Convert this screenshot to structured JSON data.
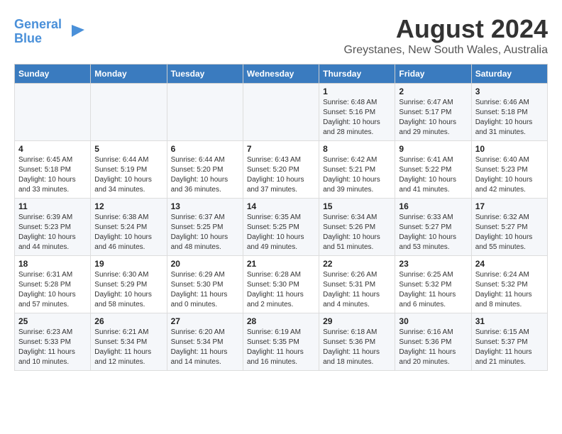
{
  "header": {
    "logo_line1": "General",
    "logo_line2": "Blue",
    "main_title": "August 2024",
    "subtitle": "Greystanes, New South Wales, Australia"
  },
  "days_of_week": [
    "Sunday",
    "Monday",
    "Tuesday",
    "Wednesday",
    "Thursday",
    "Friday",
    "Saturday"
  ],
  "weeks": [
    [
      {
        "day": "",
        "info": ""
      },
      {
        "day": "",
        "info": ""
      },
      {
        "day": "",
        "info": ""
      },
      {
        "day": "",
        "info": ""
      },
      {
        "day": "1",
        "info": "Sunrise: 6:48 AM\nSunset: 5:16 PM\nDaylight: 10 hours\nand 28 minutes."
      },
      {
        "day": "2",
        "info": "Sunrise: 6:47 AM\nSunset: 5:17 PM\nDaylight: 10 hours\nand 29 minutes."
      },
      {
        "day": "3",
        "info": "Sunrise: 6:46 AM\nSunset: 5:18 PM\nDaylight: 10 hours\nand 31 minutes."
      }
    ],
    [
      {
        "day": "4",
        "info": "Sunrise: 6:45 AM\nSunset: 5:18 PM\nDaylight: 10 hours\nand 33 minutes."
      },
      {
        "day": "5",
        "info": "Sunrise: 6:44 AM\nSunset: 5:19 PM\nDaylight: 10 hours\nand 34 minutes."
      },
      {
        "day": "6",
        "info": "Sunrise: 6:44 AM\nSunset: 5:20 PM\nDaylight: 10 hours\nand 36 minutes."
      },
      {
        "day": "7",
        "info": "Sunrise: 6:43 AM\nSunset: 5:20 PM\nDaylight: 10 hours\nand 37 minutes."
      },
      {
        "day": "8",
        "info": "Sunrise: 6:42 AM\nSunset: 5:21 PM\nDaylight: 10 hours\nand 39 minutes."
      },
      {
        "day": "9",
        "info": "Sunrise: 6:41 AM\nSunset: 5:22 PM\nDaylight: 10 hours\nand 41 minutes."
      },
      {
        "day": "10",
        "info": "Sunrise: 6:40 AM\nSunset: 5:23 PM\nDaylight: 10 hours\nand 42 minutes."
      }
    ],
    [
      {
        "day": "11",
        "info": "Sunrise: 6:39 AM\nSunset: 5:23 PM\nDaylight: 10 hours\nand 44 minutes."
      },
      {
        "day": "12",
        "info": "Sunrise: 6:38 AM\nSunset: 5:24 PM\nDaylight: 10 hours\nand 46 minutes."
      },
      {
        "day": "13",
        "info": "Sunrise: 6:37 AM\nSunset: 5:25 PM\nDaylight: 10 hours\nand 48 minutes."
      },
      {
        "day": "14",
        "info": "Sunrise: 6:35 AM\nSunset: 5:25 PM\nDaylight: 10 hours\nand 49 minutes."
      },
      {
        "day": "15",
        "info": "Sunrise: 6:34 AM\nSunset: 5:26 PM\nDaylight: 10 hours\nand 51 minutes."
      },
      {
        "day": "16",
        "info": "Sunrise: 6:33 AM\nSunset: 5:27 PM\nDaylight: 10 hours\nand 53 minutes."
      },
      {
        "day": "17",
        "info": "Sunrise: 6:32 AM\nSunset: 5:27 PM\nDaylight: 10 hours\nand 55 minutes."
      }
    ],
    [
      {
        "day": "18",
        "info": "Sunrise: 6:31 AM\nSunset: 5:28 PM\nDaylight: 10 hours\nand 57 minutes."
      },
      {
        "day": "19",
        "info": "Sunrise: 6:30 AM\nSunset: 5:29 PM\nDaylight: 10 hours\nand 58 minutes."
      },
      {
        "day": "20",
        "info": "Sunrise: 6:29 AM\nSunset: 5:30 PM\nDaylight: 11 hours\nand 0 minutes."
      },
      {
        "day": "21",
        "info": "Sunrise: 6:28 AM\nSunset: 5:30 PM\nDaylight: 11 hours\nand 2 minutes."
      },
      {
        "day": "22",
        "info": "Sunrise: 6:26 AM\nSunset: 5:31 PM\nDaylight: 11 hours\nand 4 minutes."
      },
      {
        "day": "23",
        "info": "Sunrise: 6:25 AM\nSunset: 5:32 PM\nDaylight: 11 hours\nand 6 minutes."
      },
      {
        "day": "24",
        "info": "Sunrise: 6:24 AM\nSunset: 5:32 PM\nDaylight: 11 hours\nand 8 minutes."
      }
    ],
    [
      {
        "day": "25",
        "info": "Sunrise: 6:23 AM\nSunset: 5:33 PM\nDaylight: 11 hours\nand 10 minutes."
      },
      {
        "day": "26",
        "info": "Sunrise: 6:21 AM\nSunset: 5:34 PM\nDaylight: 11 hours\nand 12 minutes."
      },
      {
        "day": "27",
        "info": "Sunrise: 6:20 AM\nSunset: 5:34 PM\nDaylight: 11 hours\nand 14 minutes."
      },
      {
        "day": "28",
        "info": "Sunrise: 6:19 AM\nSunset: 5:35 PM\nDaylight: 11 hours\nand 16 minutes."
      },
      {
        "day": "29",
        "info": "Sunrise: 6:18 AM\nSunset: 5:36 PM\nDaylight: 11 hours\nand 18 minutes."
      },
      {
        "day": "30",
        "info": "Sunrise: 6:16 AM\nSunset: 5:36 PM\nDaylight: 11 hours\nand 20 minutes."
      },
      {
        "day": "31",
        "info": "Sunrise: 6:15 AM\nSunset: 5:37 PM\nDaylight: 11 hours\nand 21 minutes."
      }
    ]
  ]
}
